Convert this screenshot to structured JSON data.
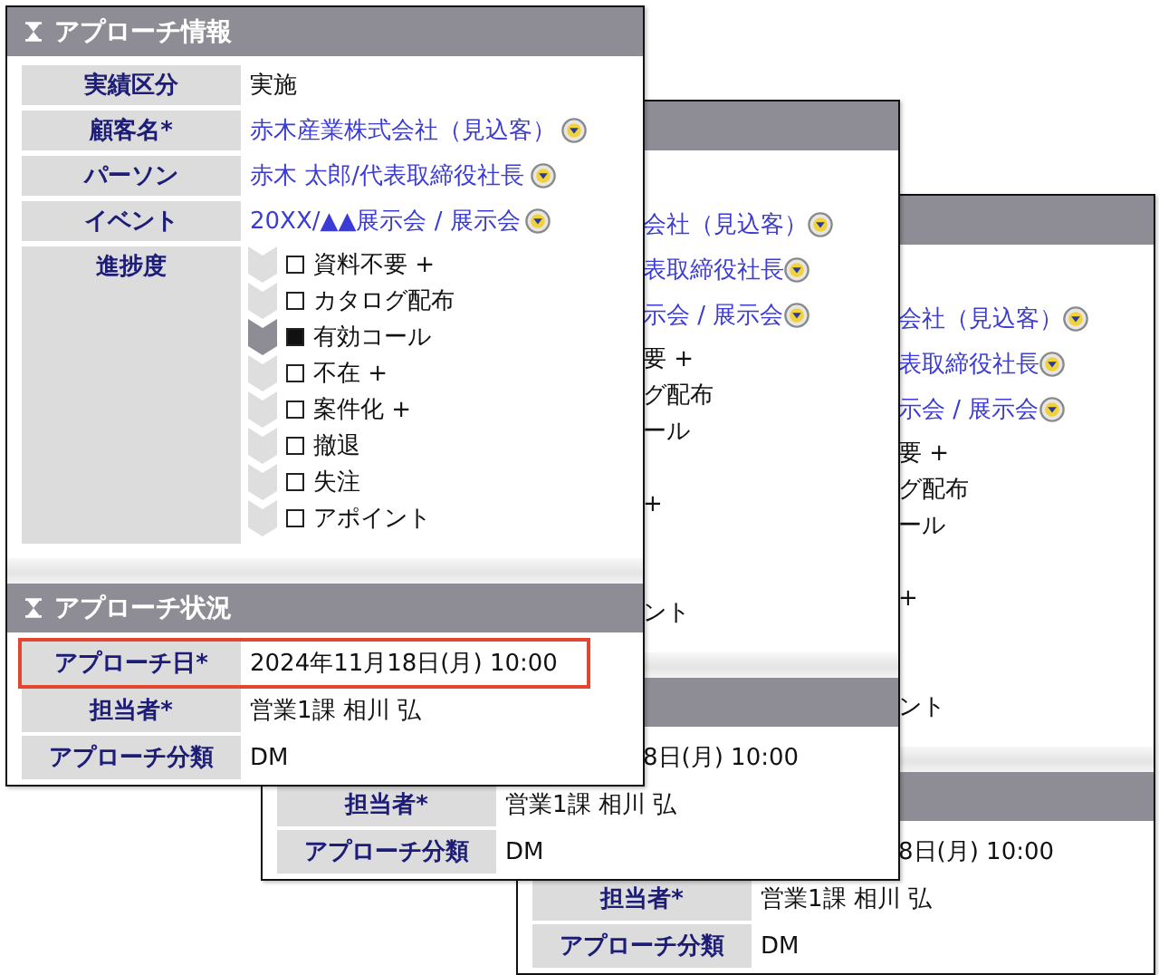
{
  "front_window": {
    "sections": [
      {
        "title": "アプローチ情報",
        "rows": [
          {
            "kind": "text",
            "label": "実績区分",
            "value": "実施"
          },
          {
            "kind": "link",
            "label": "顧客名*",
            "value": "赤木産業株式会社（見込客）",
            "menu": true
          },
          {
            "kind": "link",
            "label": "パーソン",
            "value": "赤木 太郎/代表取締役社長",
            "menu": true
          },
          {
            "kind": "link",
            "label": "イベント",
            "value": "20XX/▲▲展示会 / 展示会",
            "menu": true
          },
          {
            "kind": "steps",
            "label": "進捗度",
            "steps": [
              {
                "label": "資料不要 +",
                "checked": false
              },
              {
                "label": "カタログ配布",
                "checked": false
              },
              {
                "label": "有効コール",
                "checked": true
              },
              {
                "label": "不在 +",
                "checked": false
              },
              {
                "label": "案件化 +",
                "checked": false
              },
              {
                "label": "撤退",
                "checked": false
              },
              {
                "label": "失注",
                "checked": false
              },
              {
                "label": "アポイント",
                "checked": false
              }
            ]
          }
        ]
      },
      {
        "title": "アプローチ状況",
        "rows": [
          {
            "kind": "text",
            "label": "アプローチ日*",
            "value": "2024年11月18日(月) 10:00",
            "highlighted": true
          },
          {
            "kind": "text",
            "label": "担当者*",
            "value": "営業1課 相川 弘",
            "highlighted": false
          },
          {
            "kind": "text",
            "label": "アプローチ分類",
            "value": "DM",
            "highlighted": false
          }
        ]
      }
    ]
  },
  "back_windows": [
    {
      "info_fragments": [
        {
          "kind": "hidden"
        },
        {
          "kind": "link",
          "text": "会社（見込客）",
          "menu": true
        },
        {
          "kind": "link",
          "text": "表取締役社長",
          "menu": true
        },
        {
          "kind": "link",
          "text": "示会 / 展示会",
          "menu": true
        }
      ],
      "step_fragments": [
        {
          "kind": "text",
          "text": "要 +"
        },
        {
          "kind": "text",
          "text": "グ配布"
        },
        {
          "kind": "text",
          "text": "ール"
        },
        {
          "kind": "hidden"
        },
        {
          "kind": "text",
          "text": "+"
        },
        {
          "kind": "hidden"
        },
        {
          "kind": "hidden"
        },
        {
          "kind": "text",
          "text": "ント"
        }
      ],
      "date_fragment": "8日(月) 10:00",
      "rows": [
        {
          "label": "担当者*",
          "value": "営業1課 相川 弘"
        },
        {
          "label": "アプローチ分類",
          "value": "DM"
        }
      ]
    },
    {
      "info_fragments": [
        {
          "kind": "hidden"
        },
        {
          "kind": "link",
          "text": "会社（見込客）",
          "menu": true
        },
        {
          "kind": "link",
          "text": "表取締役社長",
          "menu": true
        },
        {
          "kind": "link",
          "text": "示会 / 展示会",
          "menu": true
        }
      ],
      "step_fragments": [
        {
          "kind": "text",
          "text": "要 +"
        },
        {
          "kind": "text",
          "text": "グ配布"
        },
        {
          "kind": "text",
          "text": "ール"
        },
        {
          "kind": "hidden"
        },
        {
          "kind": "text",
          "text": "+"
        },
        {
          "kind": "hidden"
        },
        {
          "kind": "hidden"
        },
        {
          "kind": "text",
          "text": "ント"
        }
      ],
      "date_fragment": "8日(月) 10:00",
      "rows": [
        {
          "label": "担当者*",
          "value": "営業1課 相川 弘"
        },
        {
          "label": "アプローチ分類",
          "value": "DM"
        }
      ]
    }
  ]
}
